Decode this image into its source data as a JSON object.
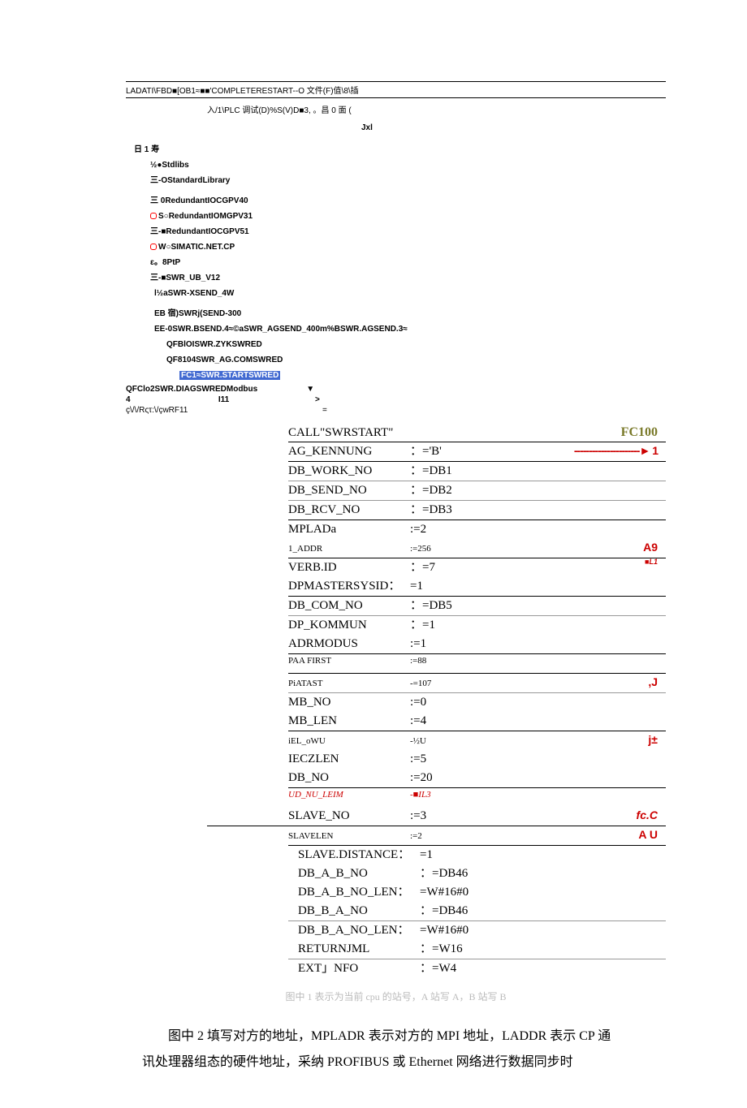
{
  "header": {
    "line1": "LADATI\\FBD■[OB1≈■■'COMPLETERESTART--O 文件(F)值\\8\\插",
    "line2": "入/1\\PLC 调试(D)%S(V)D■3, 。昌      0 面 (",
    "line3": "Jxl"
  },
  "tree": {
    "l0": "日 1 寿",
    "l1": "½●Stdlibs",
    "l2": "三-OStandardLibrary",
    "l3": "三 0RedundantIOCGPV40",
    "l4": "S○RedundantIOMGPV31",
    "l5": "三-■RedundantIOCGPV51",
    "l6": "W○SIMATIC.NET.CP",
    "l7": "ɛ。8PtP",
    "l8": "三-■SWR_UB_V12",
    "l9": "l½aSWR-XSEND_4W",
    "l10": "EB 宿)SWRj(SEND-300",
    "l11": "EE-0SWR.BSEND.4≈©aSWR_AGSEND_400m%BSWR.AGSEND.3≈",
    "l12": "QFBlOISWR.ZYKSWRED",
    "l13": "QF8104SWR_AG.COMSWRED",
    "l14": "FC1≈SWR.STARTSWRED",
    "r1a": "QFClo2SWR.DIAGSWREDModbus",
    "r1b": "▼",
    "r2a": "4",
    "r2b": "I11",
    "r2c": ">",
    "r3": "ç\\/\\/Rςτ:\\/çwRF11",
    "r3b": "="
  },
  "code": [
    {
      "k": "CALL\"SWRSTART\"",
      "v": "",
      "ann": "FC100",
      "cls": "underline-strong",
      "annCls": "olive"
    },
    {
      "k": "AG_KENNUNG",
      "v": "：='B'",
      "ann": "----------------------► 1",
      "cls": "underline-strong",
      "annCls": "arrow"
    },
    {
      "k": "DB_WORK_NO",
      "v": "：=DB1",
      "ann": "",
      "cls": "underline-lt"
    },
    {
      "k": "DB_SEND_NO",
      "v": "：=DB2",
      "ann": "",
      "cls": "underline-lt"
    },
    {
      "k": "DB_RCV_NO",
      "v": "：=DB3",
      "ann": "",
      "cls": "underline-strong"
    },
    {
      "k": "MPLADa",
      "v": ":=2",
      "ann": "",
      "cls": ""
    },
    {
      "k": "1_ADDR",
      "v": ":=256",
      "ann": "A9",
      "cls": "underline-strong mini",
      "annCls": ""
    },
    {
      "k": "",
      "v": "",
      "ann": "■L1",
      "annCls": "red-ital mini",
      "inlineAbove": true
    },
    {
      "k": "VERB.ID",
      "v": "：=7",
      "ann": "",
      "cls": ""
    },
    {
      "k": "DPMASTERSYSID：",
      "v": "=1",
      "ann": "",
      "cls": "underline-strong"
    },
    {
      "k": "DB_COM_NO",
      "v": "：=DB5",
      "ann": "",
      "cls": "underline-lt"
    },
    {
      "k": "DP_KOMMUN",
      "v": "：=1",
      "ann": "",
      "cls": ""
    },
    {
      "k": "ADRMODUS",
      "v": ":=1",
      "ann": "",
      "cls": "underline-strong"
    },
    {
      "k": "PAA FIRST",
      "v": ":=88",
      "ann": "",
      "cls": "underline-strong mini"
    },
    {
      "k": "PiATAST",
      "v": "-=107",
      "ann": ",J",
      "cls": "underline-lt mini",
      "annCls": ""
    },
    {
      "k": "MB_NO",
      "v": ":=0",
      "ann": "",
      "cls": ""
    },
    {
      "k": "MB_LEN",
      "v": ":=4",
      "ann": "",
      "cls": "underline-strong"
    },
    {
      "k": "iEL_oWU",
      "v": "-½U",
      "ann": "j±",
      "cls": "mini",
      "annCls": ""
    },
    {
      "k": "IECZLEN",
      "v": ":=5",
      "ann": "",
      "cls": ""
    },
    {
      "k": "DB_NO",
      "v": ":=20",
      "ann": "",
      "cls": "underline-strong"
    },
    {
      "k": "UD_NU_LEIM",
      "v": "-■IL3",
      "ann": "",
      "cls": "mini red-ital"
    },
    {
      "k": "SLAVE_NO",
      "v": ":=3",
      "ann": "fc.C",
      "cls": "underline-strong",
      "annCls": "red-ital",
      "rule": true
    },
    {
      "k": "SLAVELEN",
      "v": ":=2",
      "ann": "A U",
      "cls": "underline-strong mini",
      "annCls": ""
    },
    {
      "k": "SLAVE.DISTANCE：",
      "v": "=1",
      "ann": "",
      "cls": "",
      "pad": true
    },
    {
      "k": "DB_A_B_NO",
      "v": "：=DB46",
      "ann": "",
      "cls": "",
      "pad": true
    },
    {
      "k": "DB_A_B_NO_LEN：",
      "v": "=W#16#0",
      "ann": "",
      "cls": "",
      "pad": true
    },
    {
      "k": "DB_B_A_NO",
      "v": "：=DB46",
      "ann": "",
      "cls": "underline-lt",
      "pad": true
    },
    {
      "k": "DB_B_A_NO_LEN：",
      "v": "=W#16#0",
      "ann": "",
      "cls": "",
      "pad": true
    },
    {
      "k": "RETURNJML",
      "v": "：=W16",
      "ann": "",
      "cls": "underline-lt",
      "pad": true
    },
    {
      "k": "EXT」NFO",
      "v": "：=W4",
      "ann": "",
      "cls": "",
      "pad": true
    }
  ],
  "faint_note": "图中 1 表示为当前 cpu 的站号，A 站写 A，B 站写 B",
  "paragraph": "图中 2 填写对方的地址，MPLADR 表示对方的 MPI 地址，LADDR 表示 CP 通讯处理器组态的硬件地址，采纳 PROFIBUS 或 Ethernet 网络进行数据同步时"
}
